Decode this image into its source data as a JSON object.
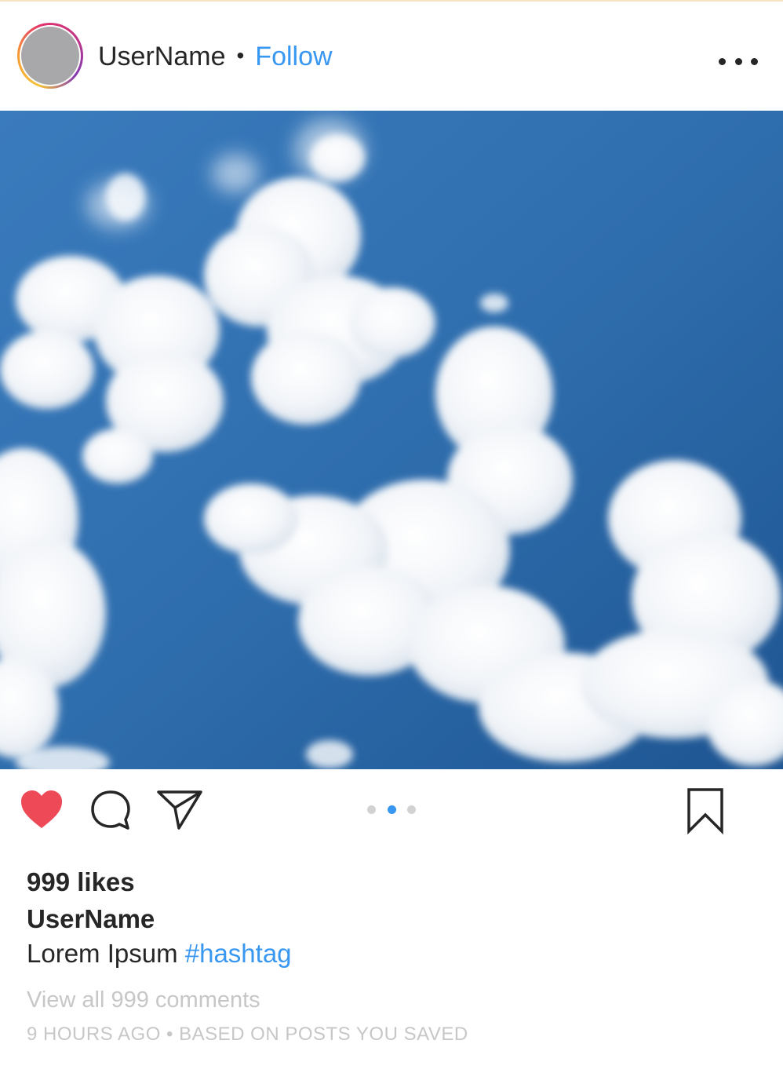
{
  "header": {
    "username": "UserName",
    "separator": "•",
    "follow_label": "Follow",
    "more_icon": "more-horizontal-icon"
  },
  "post": {
    "image_alt": "Blue sky with white clouds",
    "carousel": {
      "count": 3,
      "active_index": 1
    }
  },
  "actions": {
    "like_icon": "heart-filled-icon",
    "comment_icon": "comment-icon",
    "share_icon": "paper-plane-icon",
    "save_icon": "bookmark-icon",
    "liked": true
  },
  "details": {
    "likes": "999 likes",
    "caption_user": "UserName",
    "caption_text": "Lorem Ipsum",
    "hashtag": "#hashtag",
    "comments_link": "View all 999 comments",
    "timestamp": "9 HOURS AGO",
    "meta_separator": "•",
    "context": "BASED ON POSTS YOU SAVED"
  },
  "colors": {
    "link_blue": "#3897f0",
    "heart_red": "#ed4956",
    "muted_gray": "#c7c7c7",
    "text_dark": "#262626",
    "sky_blue": "#2e6aa8"
  }
}
